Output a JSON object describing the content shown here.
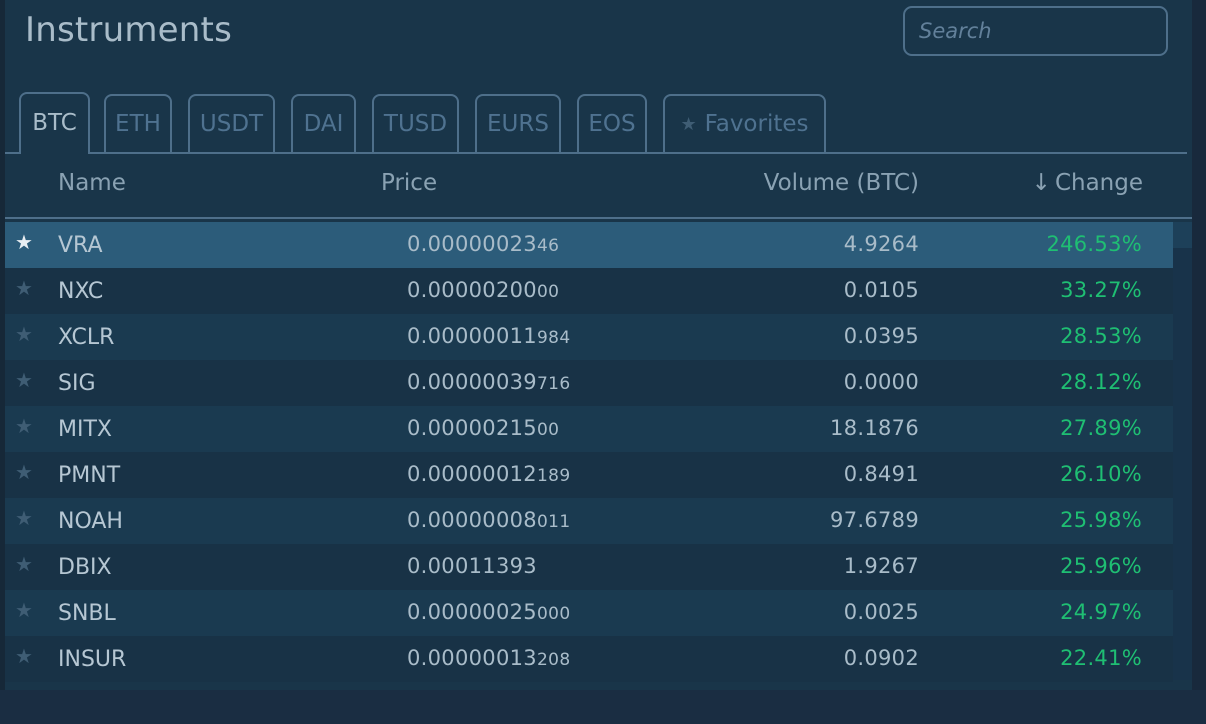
{
  "header": {
    "title": "Instruments",
    "search_placeholder": "Search",
    "search_value": ""
  },
  "tabs": [
    {
      "label": "BTC",
      "active": true
    },
    {
      "label": "ETH",
      "active": false
    },
    {
      "label": "USDT",
      "active": false
    },
    {
      "label": "DAI",
      "active": false
    },
    {
      "label": "TUSD",
      "active": false
    },
    {
      "label": "EURS",
      "active": false
    },
    {
      "label": "EOS",
      "active": false
    },
    {
      "label": "Favorites",
      "active": false,
      "icon": "star-icon"
    }
  ],
  "table": {
    "columns": {
      "name": "Name",
      "price": "Price",
      "volume": "Volume (BTC)",
      "change": "Change",
      "change_sort_icon": "arrow-down-icon"
    },
    "rows": [
      {
        "name": "VRA",
        "price_main": "0.0000002",
        "price_small": "346",
        "price_display": "0.000000234",
        "volume": "4.9264",
        "change": "246.53%",
        "favorite": true,
        "selected": true
      },
      {
        "name": "NXC",
        "price_main": "0.0000020",
        "price_small": "000",
        "volume": "0.0105",
        "change": "33.27%",
        "favorite": false,
        "selected": false
      },
      {
        "name": "XCLR",
        "price_main": "0.00000011",
        "price_small": "984",
        "volume": "0.0395",
        "change": "28.53%",
        "favorite": false,
        "selected": false
      },
      {
        "name": "SIG",
        "price_main": "0.00000039",
        "price_small": "716",
        "volume": "0.0000",
        "change": "28.12%",
        "favorite": false,
        "selected": false
      },
      {
        "name": "MITX",
        "price_main": "0.0000021",
        "price_small": "500",
        "volume": "18.1876",
        "change": "27.89%",
        "favorite": false,
        "selected": false
      },
      {
        "name": "PMNT",
        "price_main": "0.00000012",
        "price_small": "189",
        "volume": "0.8491",
        "change": "26.10%",
        "favorite": false,
        "selected": false
      },
      {
        "name": "NOAH",
        "price_main": "0.00000008",
        "price_small": "011",
        "volume": "97.6789",
        "change": "25.98%",
        "favorite": false,
        "selected": false
      },
      {
        "name": "DBIX",
        "price_main": "0.00011393",
        "price_small": "",
        "volume": "1.9267",
        "change": "25.96%",
        "favorite": false,
        "selected": false
      },
      {
        "name": "SNBL",
        "price_main": "0.00000025",
        "price_small": "000",
        "volume": "0.0025",
        "change": "24.97%",
        "favorite": false,
        "selected": false
      },
      {
        "name": "INSUR",
        "price_main": "0.00000013",
        "price_small": "208",
        "volume": "0.0902",
        "change": "22.41%",
        "favorite": false,
        "selected": false
      }
    ]
  },
  "colors": {
    "positive_change": "#1fbf73",
    "accent_border": "#4e6f8a",
    "selected_row": "#2c5c7a"
  }
}
